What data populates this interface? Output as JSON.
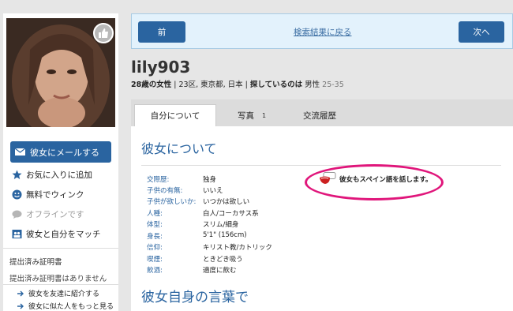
{
  "sidebar": {
    "mail_label": "彼女にメールする",
    "actions": [
      {
        "label": "お気に入りに追加",
        "icon": "star-icon"
      },
      {
        "label": "無料でウィンク",
        "icon": "smiley-icon"
      },
      {
        "label": "オフラインです",
        "icon": "chat-bubble-icon"
      },
      {
        "label": "彼女と自分をマッチ",
        "icon": "match-icon"
      }
    ],
    "cert_heading": "提出済み証明書",
    "cert_none": "提出済み証明書はありません",
    "links": [
      {
        "label": "彼女を友達に紹介する",
        "icon": "arrow-right-icon"
      },
      {
        "label": "彼女に似た人をもっと見る",
        "icon": "arrow-right-icon"
      }
    ]
  },
  "nav": {
    "prev_label": "前",
    "back_label": "検索結果に戻る",
    "next_label": "次へ"
  },
  "profile": {
    "username": "lily903",
    "age_gender": "28歳の女性",
    "location": " | 23区, 東京都, 日本 | ",
    "seeking_label": "探しているのは",
    "seeking_value": " 男性 ",
    "seeking_age": "25-35"
  },
  "tabs": [
    {
      "label": "自分について"
    },
    {
      "label": "写真",
      "count": "1"
    },
    {
      "label": "交流履歴"
    }
  ],
  "about": {
    "title": "彼女について",
    "details": [
      {
        "label": "交際歴:",
        "value": "独身"
      },
      {
        "label": "子供の有無:",
        "value": "いいえ"
      },
      {
        "label": "子供が欲しいか:",
        "value": "いつかは欲しい"
      },
      {
        "label": "人種:",
        "value": "白人/コーカサス系"
      },
      {
        "label": "体型:",
        "value": "スリム/細身"
      },
      {
        "label": "身長:",
        "value": "5'1\" (156cm)"
      },
      {
        "label": "信仰:",
        "value": "キリスト教/カトリック"
      },
      {
        "label": "喫煙:",
        "value": "ときどき吸う"
      },
      {
        "label": "飲酒:",
        "value": "適度に飲む"
      }
    ],
    "language_note": "彼女もスペイン語を話します。"
  },
  "own_words": {
    "title": "彼女自身の言葉で"
  },
  "colors": {
    "primary": "#2a64a0",
    "highlight": "#e0167b"
  }
}
